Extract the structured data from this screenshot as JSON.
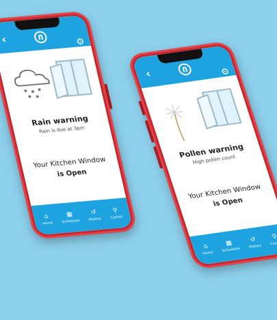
{
  "colors": {
    "background": "#8ed0ec",
    "phone_frame": "#c9252d",
    "accent": "#1ea3e0"
  },
  "phones": [
    {
      "warning_title": "Rain warning",
      "warning_sub": "Rain is due at 3pm",
      "status_line1": "Your Kitchen Window",
      "status_line2": "is Open",
      "illustration": "rain-cloud-icon",
      "nav": [
        {
          "label": "Home",
          "icon": "home-icon"
        },
        {
          "label": "Schedules",
          "icon": "calendar-icon"
        },
        {
          "label": "History",
          "icon": "history-icon"
        },
        {
          "label": "Control",
          "icon": "control-icon"
        }
      ]
    },
    {
      "warning_title": "Pollen warning",
      "warning_sub": "High pollen count",
      "status_line1": "Your Kitchen Window",
      "status_line2": "is Open",
      "illustration": "dandelion-icon",
      "nav": [
        {
          "label": "Home",
          "icon": "home-icon"
        },
        {
          "label": "Schedules",
          "icon": "calendar-icon"
        },
        {
          "label": "History",
          "icon": "history-icon"
        },
        {
          "label": "Control",
          "icon": "control-icon"
        }
      ]
    }
  ]
}
